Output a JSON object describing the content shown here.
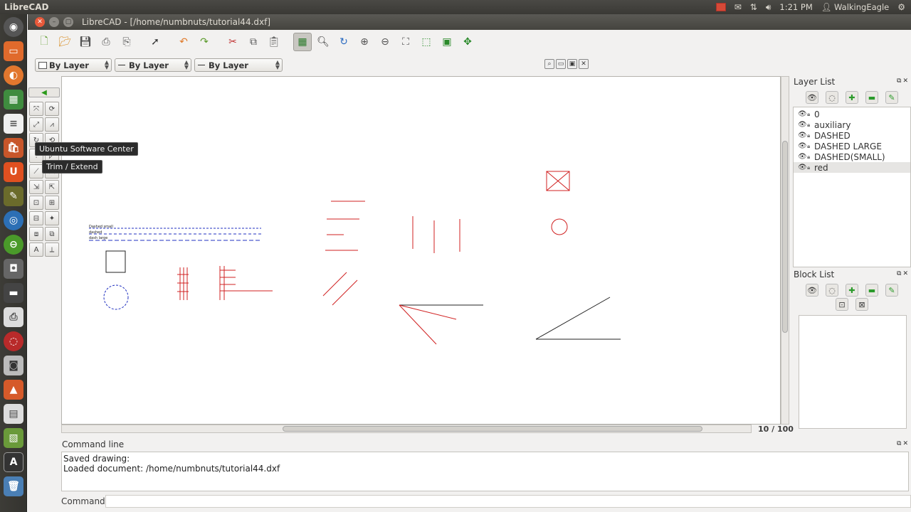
{
  "top_panel": {
    "app_name": "LibreCAD",
    "time": "1:21 PM",
    "user": "WalkingEagle"
  },
  "window": {
    "title": "LibreCAD - [/home/numbnuts/tutorial44.dxf]"
  },
  "layer_bar": {
    "color_combo": "By Layer",
    "width_combo": "By Layer",
    "linetype_combo": "By Layer"
  },
  "tooltips": {
    "software_center": "Ubuntu Software Center",
    "trim_extend": "Trim / Extend"
  },
  "drawing": {
    "text_labels": [
      "Dashed small",
      "dashed",
      "dash large"
    ],
    "colors": {
      "red": "#d02020",
      "blue": "#2030c0",
      "black": "#202020"
    }
  },
  "status": {
    "grid": "10 / 100"
  },
  "layer_list": {
    "title": "Layer List",
    "layers": [
      {
        "name": "0",
        "selected": false
      },
      {
        "name": "auxiliary",
        "selected": false
      },
      {
        "name": "DASHED",
        "selected": false
      },
      {
        "name": "DASHED LARGE",
        "selected": false
      },
      {
        "name": "DASHED(SMALL)",
        "selected": false
      },
      {
        "name": "red",
        "selected": true
      }
    ]
  },
  "block_list": {
    "title": "Block List"
  },
  "command_line": {
    "title": "Command line",
    "history": [
      "Saved drawing:",
      "Loaded document: /home/numbnuts/tutorial44.dxf"
    ],
    "prompt_label": "Command:",
    "input_value": ""
  }
}
